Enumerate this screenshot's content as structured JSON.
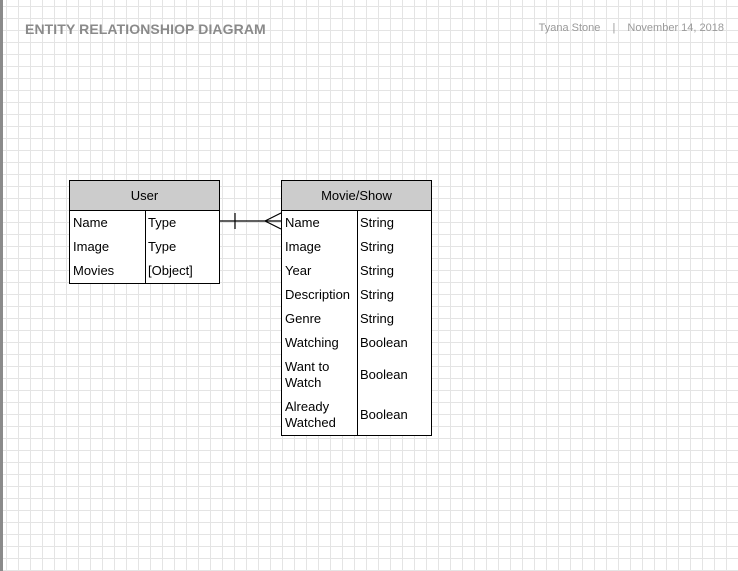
{
  "header": {
    "title": "ENTITY RELATIONSHIOP DIAGRAM",
    "author": "Tyana Stone",
    "separator": "|",
    "date": "November 14, 2018"
  },
  "entities": {
    "user": {
      "name": "User",
      "fields": [
        {
          "name": "Name",
          "type": "Type"
        },
        {
          "name": "Image",
          "type": "Type"
        },
        {
          "name": "Movies",
          "type": "[Object]"
        }
      ]
    },
    "movie": {
      "name": "Movie/Show",
      "fields": [
        {
          "name": "Name",
          "type": "String"
        },
        {
          "name": "Image",
          "type": "String"
        },
        {
          "name": "Year",
          "type": "String"
        },
        {
          "name": "Description",
          "type": "String"
        },
        {
          "name": "Genre",
          "type": "String"
        },
        {
          "name": "Watching",
          "type": "Boolean"
        },
        {
          "name": "Want to Watch",
          "type": "Boolean"
        },
        {
          "name": "Already Watched",
          "type": "Boolean"
        }
      ]
    }
  },
  "relationship": {
    "from": "User",
    "to": "Movie/Show",
    "from_cardinality": "one",
    "to_cardinality": "many"
  }
}
